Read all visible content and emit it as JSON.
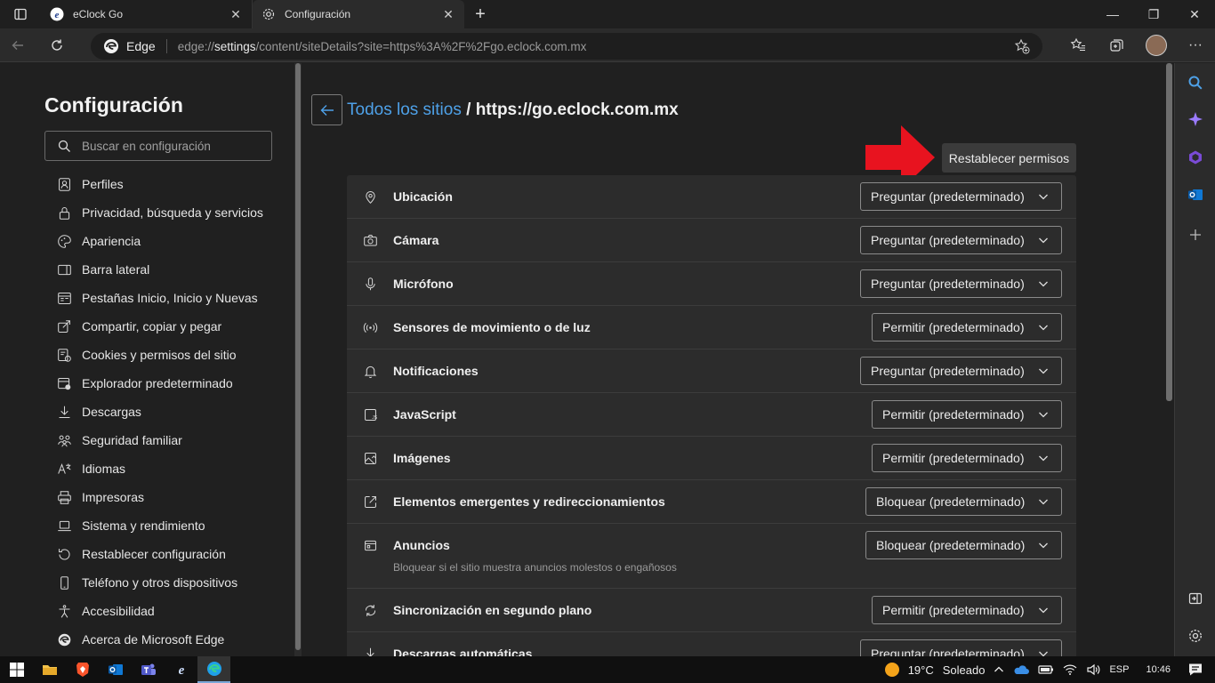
{
  "tabs": [
    {
      "title": "eClock Go",
      "active": false
    },
    {
      "title": "Configuración",
      "active": true
    }
  ],
  "address": {
    "edge_label": "Edge",
    "url_prefix": "edge://",
    "url_host": "settings",
    "url_path": "/content/siteDetails?site=https%3A%2F%2Fgo.eclock.com.mx"
  },
  "sidebar": {
    "title": "Configuración",
    "search_placeholder": "Buscar en configuración",
    "items": [
      {
        "label": "Perfiles",
        "icon": "profile-icon"
      },
      {
        "label": "Privacidad, búsqueda y servicios",
        "icon": "lock-icon"
      },
      {
        "label": "Apariencia",
        "icon": "palette-icon"
      },
      {
        "label": "Barra lateral",
        "icon": "sidebar-icon"
      },
      {
        "label": "Pestañas Inicio, Inicio y Nuevas",
        "icon": "tabs-icon"
      },
      {
        "label": "Compartir, copiar y pegar",
        "icon": "share-icon"
      },
      {
        "label": "Cookies y permisos del sitio",
        "icon": "cookies-icon"
      },
      {
        "label": "Explorador predeterminado",
        "icon": "browser-icon"
      },
      {
        "label": "Descargas",
        "icon": "download-icon"
      },
      {
        "label": "Seguridad familiar",
        "icon": "family-icon"
      },
      {
        "label": "Idiomas",
        "icon": "language-icon"
      },
      {
        "label": "Impresoras",
        "icon": "printer-icon"
      },
      {
        "label": "Sistema y rendimiento",
        "icon": "laptop-icon"
      },
      {
        "label": "Restablecer configuración",
        "icon": "reset-icon"
      },
      {
        "label": "Teléfono y otros dispositivos",
        "icon": "phone-icon"
      },
      {
        "label": "Accesibilidad",
        "icon": "accessibility-icon"
      },
      {
        "label": "Acerca de Microsoft Edge",
        "icon": "edge-icon"
      }
    ]
  },
  "main": {
    "breadcrumb_link": "Todos los sitios",
    "breadcrumb_sep": " / ",
    "site": "https://go.eclock.com.mx",
    "reset_button": "Restablecer permisos",
    "permissions": [
      {
        "label": "Ubicación",
        "value": "Preguntar (predeterminado)",
        "icon": "location-icon"
      },
      {
        "label": "Cámara",
        "value": "Preguntar (predeterminado)",
        "icon": "camera-icon"
      },
      {
        "label": "Micrófono",
        "value": "Preguntar (predeterminado)",
        "icon": "microphone-icon"
      },
      {
        "label": "Sensores de movimiento o de luz",
        "value": "Permitir (predeterminado)",
        "icon": "sensor-icon"
      },
      {
        "label": "Notificaciones",
        "value": "Preguntar (predeterminado)",
        "icon": "bell-icon"
      },
      {
        "label": "JavaScript",
        "value": "Permitir (predeterminado)",
        "icon": "javascript-icon"
      },
      {
        "label": "Imágenes",
        "value": "Permitir (predeterminado)",
        "icon": "image-icon"
      },
      {
        "label": "Elementos emergentes y redireccionamientos",
        "value": "Bloquear (predeterminado)",
        "icon": "popup-icon"
      },
      {
        "label": "Anuncios",
        "value": "Bloquear (predeterminado)",
        "icon": "ads-icon",
        "description": "Bloquear si el sitio muestra anuncios molestos o engañosos"
      },
      {
        "label": "Sincronización en segundo plano",
        "value": "Permitir (predeterminado)",
        "icon": "sync-icon"
      },
      {
        "label": "Descargas automáticas",
        "value": "Preguntar (predeterminado)",
        "icon": "download-icon"
      }
    ]
  },
  "taskbar": {
    "weather_temp": "19°C",
    "weather_text": "Soleado",
    "language": "ESP",
    "time": "10:46"
  },
  "colors": {
    "accent": "#4ea1e8",
    "arrow": "#e8131f"
  }
}
